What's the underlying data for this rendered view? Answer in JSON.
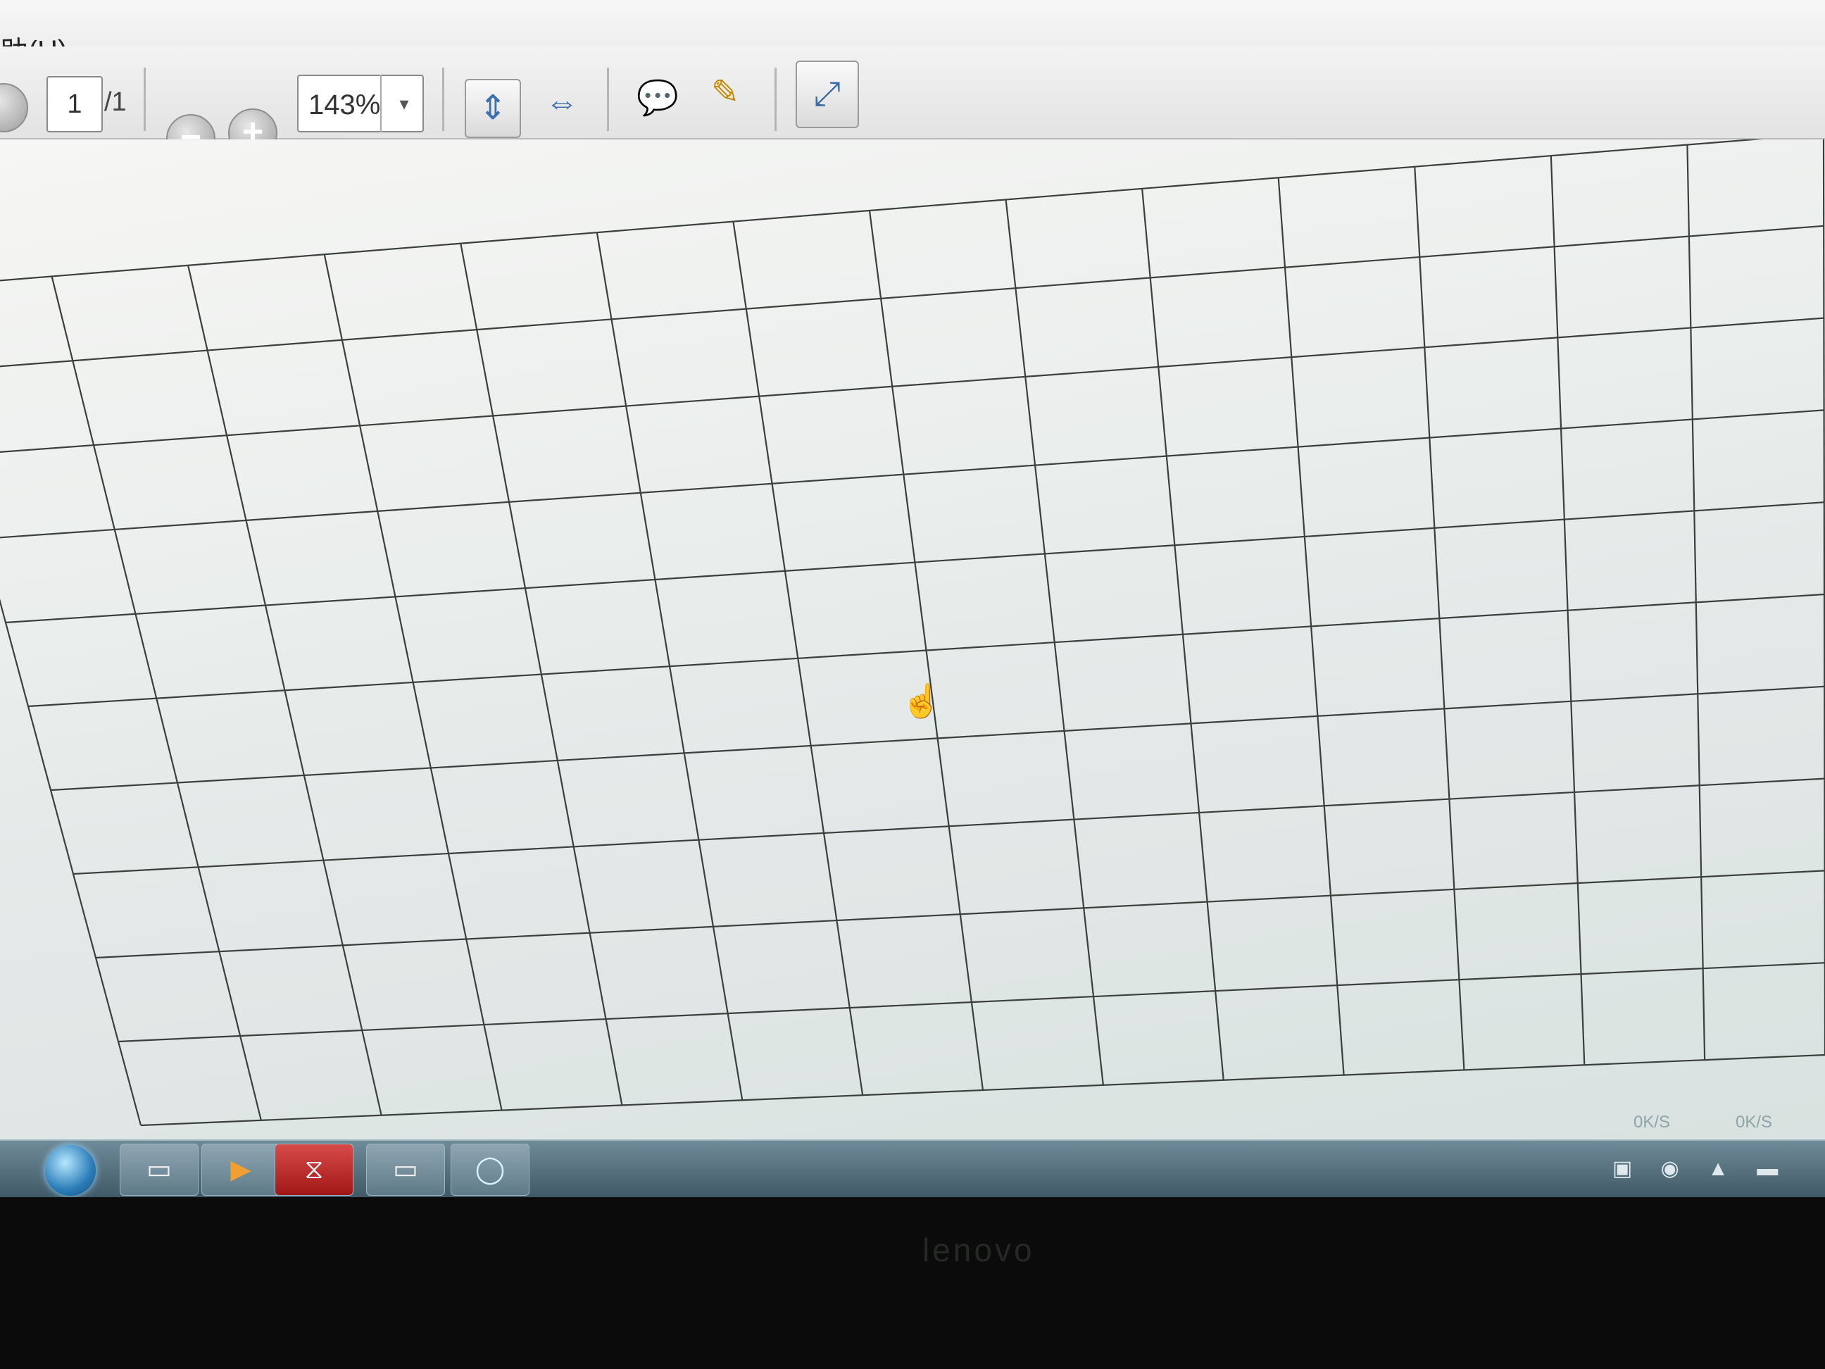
{
  "menu": {
    "help_label": "助(H)"
  },
  "toolbar": {
    "current_page": "1",
    "total_pages": "/1",
    "zoom_value": "143%",
    "zoom_out_symbol": "−",
    "zoom_in_symbol": "+",
    "dropdown_symbol": "▾",
    "fit_page_icon": "⇕",
    "fit_width_icon": "⇔",
    "comment_icon": "💬",
    "highlight_icon": "✎",
    "fullscreen_icon": "⤢"
  },
  "document": {
    "cursor_icon": "☝",
    "grid_rows": 10,
    "grid_cols": 14,
    "grid_line_color": "#3b3f3c"
  },
  "statusbar": {
    "net_up": "0K/S",
    "net_down": "0K/S"
  },
  "taskbar": {
    "explorer_icon": "▭",
    "media_icon": "▶",
    "acrobat_icon": "⧖",
    "notepad_icon": "▭",
    "browser_icon": "◯",
    "tray_icons": "▣ ◉ ▲ ▬"
  },
  "bezel": {
    "brand": "lenovo"
  },
  "colors": {
    "taskbar": "#4d6775",
    "acrobat_red": "#c62828",
    "accent_blue": "#3b6fb0"
  }
}
